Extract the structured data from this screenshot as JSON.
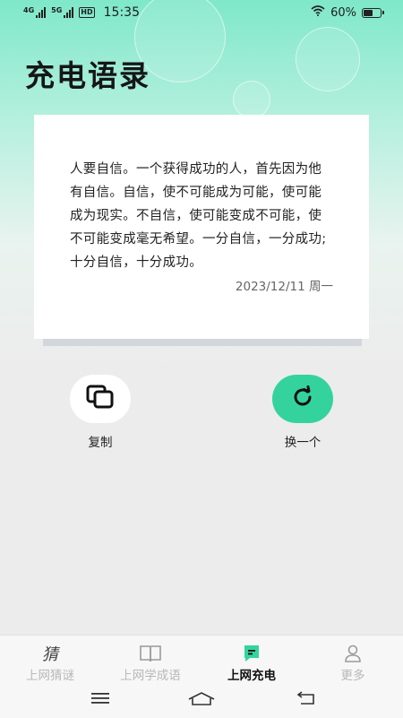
{
  "status_bar": {
    "net1": "4G",
    "net2": "5G",
    "hd": "HD",
    "time": "15:35",
    "battery_text": "60%",
    "battery_level": 0.6
  },
  "page": {
    "title": "充电语录"
  },
  "quote": {
    "text": "人要自信。一个获得成功的人，首先因为他有自信。自信，使不可能成为可能，使可能成为现实。不自信，使可能变成不可能，使不可能变成毫无希望。一分自信，一分成功;十分自信，十分成功。",
    "date": "2023/12/11 周一"
  },
  "actions": {
    "copy_label": "复制",
    "refresh_label": "换一个"
  },
  "tabs": [
    {
      "label": "上网猜谜",
      "icon": "guess-char-icon",
      "glyph": "猜"
    },
    {
      "label": "上网学成语",
      "icon": "book-icon"
    },
    {
      "label": "上网充电",
      "icon": "chat-bubble-icon",
      "active": true
    },
    {
      "label": "更多",
      "icon": "person-icon"
    }
  ],
  "colors": {
    "accent": "#34d39e",
    "header_gradient_top": "#7fe8c9",
    "background": "#ececec"
  }
}
